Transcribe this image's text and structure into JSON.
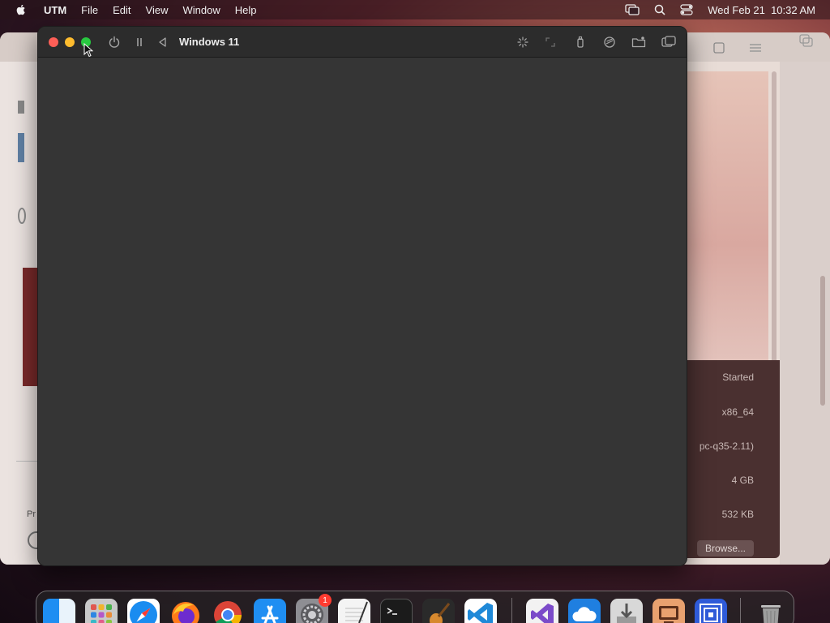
{
  "menubar": {
    "app": "UTM",
    "items": [
      "File",
      "Edit",
      "View",
      "Window",
      "Help"
    ],
    "datetime": "Wed Feb 21  10:32 AM"
  },
  "vm_window": {
    "title": "Windows 11",
    "toolbar_icons": [
      "power-icon",
      "pause-icon",
      "back-icon",
      "capture-input-icon",
      "resize-icon",
      "usb-icon",
      "drive-icon",
      "shared-folder-icon",
      "windows-icon"
    ]
  },
  "background_window": {
    "properties": {
      "status": "Started",
      "architecture": "x86_64",
      "machine": "pc-q35-2.11)",
      "memory": "4 GB",
      "size": "532 KB"
    },
    "browse_label": "Browse...",
    "left_text": "Pr"
  },
  "dock": {
    "apps": [
      "finder",
      "launchpad",
      "safari",
      "firefox",
      "chrome",
      "app-store",
      "system-settings",
      "textedit",
      "terminal",
      "garageband",
      "vscode",
      "visual-studio",
      "icloud",
      "installer",
      "utm-ish",
      "remote-desktop",
      "trash"
    ],
    "settings_badge": "1"
  },
  "colors": {
    "close": "#fe5f57",
    "minimize": "#febc2e",
    "maximize": "#28c840",
    "vm_background": "#353535"
  }
}
